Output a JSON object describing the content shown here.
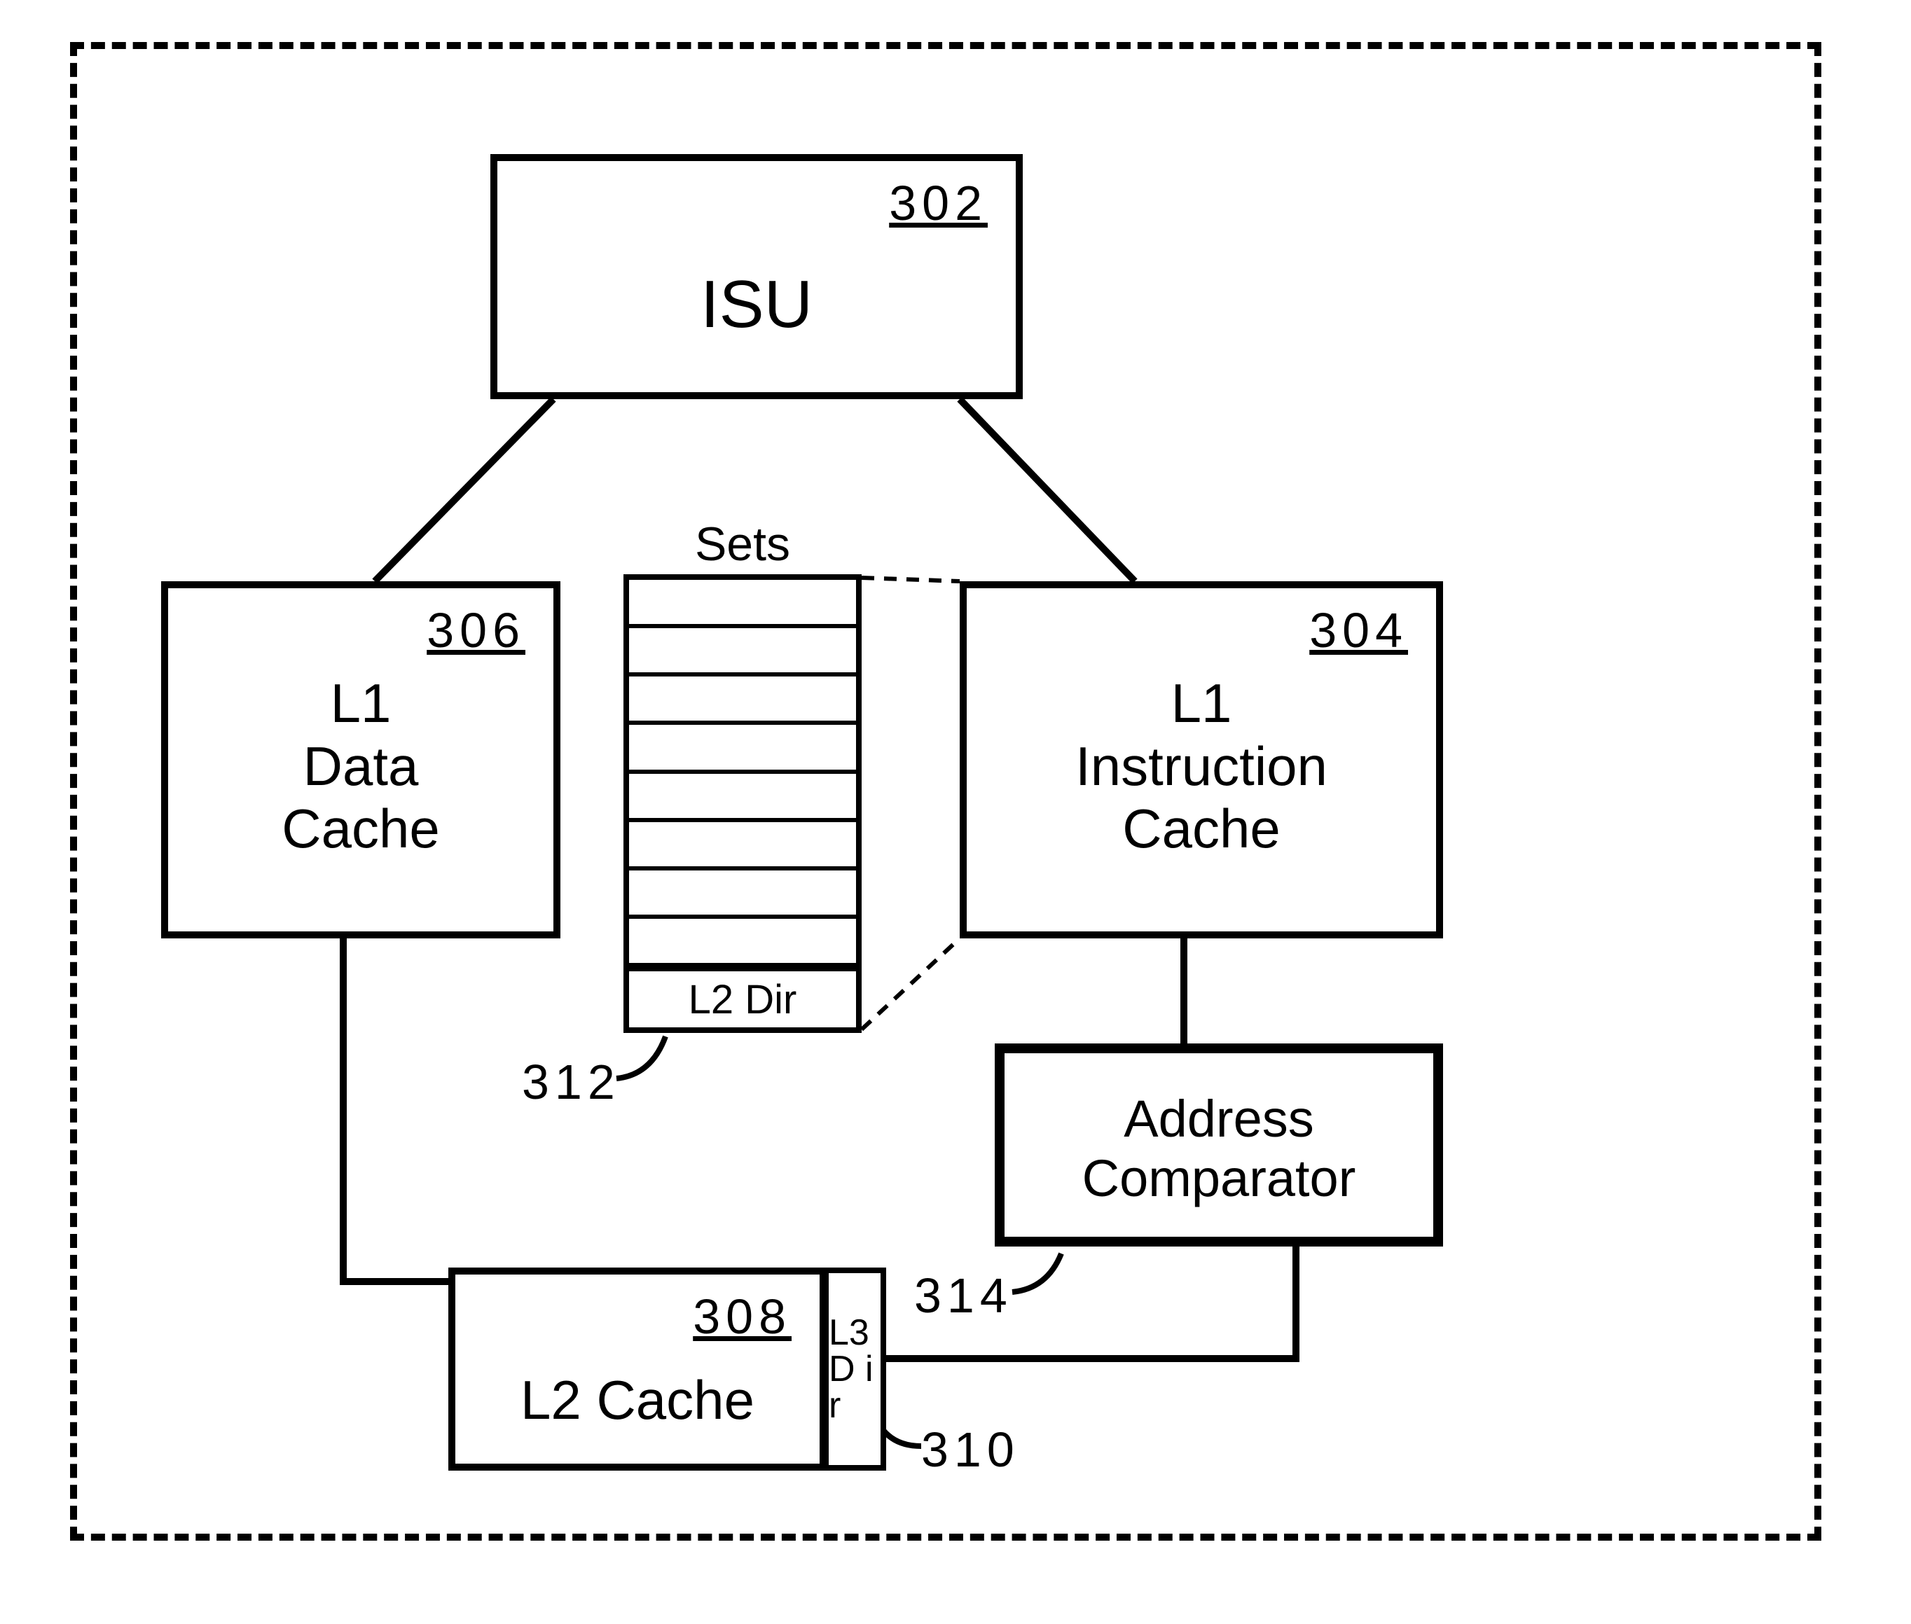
{
  "blocks": {
    "isu": {
      "text": "ISU",
      "ref": "302"
    },
    "l1data": {
      "text": "L1\nData\nCache",
      "ref": "306"
    },
    "l1instr": {
      "text": "L1\nInstruction\nCache",
      "ref": "304"
    },
    "l2cache": {
      "text": "L2 Cache",
      "ref": "308"
    },
    "addrcmp": {
      "text": "Address\nComparator",
      "ref": "314"
    },
    "l3dir": {
      "text": "L3\nD\ni\nr",
      "ref": "310"
    }
  },
  "sets": {
    "title": "Sets",
    "dir_label": "L2 Dir",
    "ref": "312",
    "rows": 8
  }
}
